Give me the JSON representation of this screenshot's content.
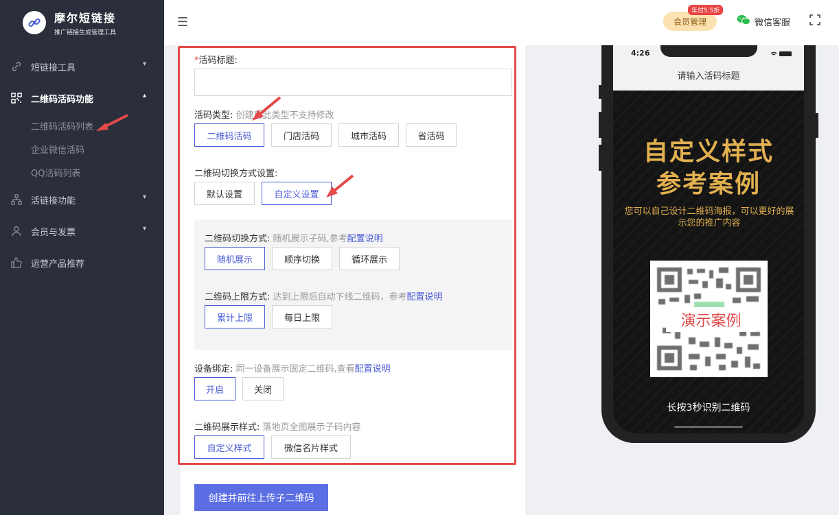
{
  "brand": {
    "title": "摩尔短链接",
    "subtitle": "推广链接生成管理工具"
  },
  "sidebar": {
    "items": [
      {
        "label": "短链接工具",
        "icon": "link-icon"
      },
      {
        "label": "二维码活码功能",
        "icon": "qrcode-icon"
      },
      {
        "label": "活链接功能",
        "icon": "sitemap-icon"
      },
      {
        "label": "会员与发票",
        "icon": "user-icon"
      },
      {
        "label": "运营产品推荐",
        "icon": "thumbs-up-icon"
      }
    ],
    "subitems": [
      "二维码活码列表",
      "企业微信活码",
      "QQ活码列表"
    ]
  },
  "header": {
    "vip_label": "会员管理",
    "vip_badge": "年付5.5折",
    "wechat_label": "微信客服"
  },
  "form": {
    "title_label": "活码标题:",
    "title_value": "",
    "type_label": "活码类型:",
    "type_hint": "创建后此类型不支持修改",
    "type_options": [
      "二维码活码",
      "门店活码",
      "城市活码",
      "省活码"
    ],
    "switch_setting_label": "二维码切换方式设置:",
    "switch_setting_options": [
      "默认设置",
      "自定义设置"
    ],
    "switch_mode_label": "二维码切换方式:",
    "switch_mode_hint": "随机展示子码,参考",
    "config_link": "配置说明",
    "switch_mode_options": [
      "随机展示",
      "顺序切换",
      "循环展示"
    ],
    "limit_label": "二维码上限方式:",
    "limit_hint": "达到上限后自动下线二维码，参考",
    "limit_options": [
      "累计上限",
      "每日上限"
    ],
    "device_label": "设备绑定:",
    "device_hint": "同一设备展示固定二维码,查看",
    "device_options": [
      "开启",
      "关闭"
    ],
    "display_label": "二维码展示样式:",
    "display_hint": "落地页全图展示子码内容",
    "display_options": [
      "自定义样式",
      "微信名片样式"
    ],
    "submit_label": "创建并前往上传子二维码"
  },
  "preview": {
    "time": "4:26",
    "page_title": "请输入活码标题",
    "heading_line1": "自定义样式",
    "heading_line2": "参考案例",
    "description": "您可以自己设计二维码海报，可以更好的展示您的推广内容",
    "demo_label": "演示案例",
    "long_press": "长按3秒识别二维码"
  },
  "colors": {
    "sidebar_bg": "#2b2f3b",
    "accent": "#4a5cd6",
    "highlight_frame": "#e34a4a",
    "poster_gold": "#e2b04f"
  }
}
